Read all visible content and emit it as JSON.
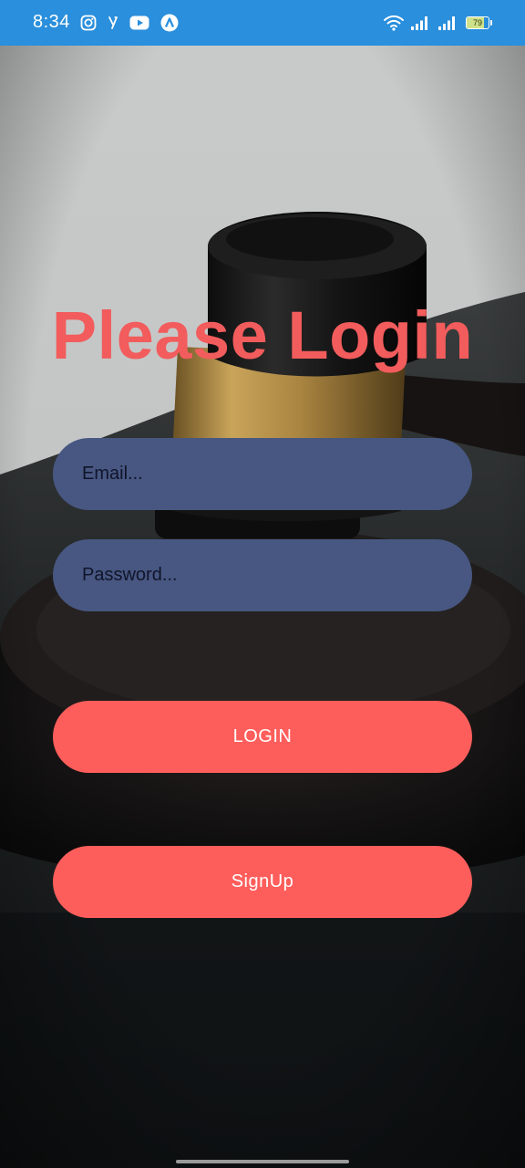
{
  "status_bar": {
    "time": "8:34",
    "left_icons": [
      "instagram-icon",
      "yappy-icon",
      "youtube-icon",
      "app-a-icon"
    ],
    "right_icons": [
      "wifi-icon",
      "signal-icon",
      "signal-icon-2",
      "battery-icon"
    ],
    "battery_level": "79",
    "color": "#2a8fdc"
  },
  "login": {
    "title": "Please Login",
    "email_placeholder": "Email...",
    "password_placeholder": "Password...",
    "login_label": "LOGIN",
    "signup_label": "SignUp"
  },
  "colors": {
    "accent": "#fe5e5b",
    "title": "#f25c5c",
    "field_bg": "#475781"
  }
}
